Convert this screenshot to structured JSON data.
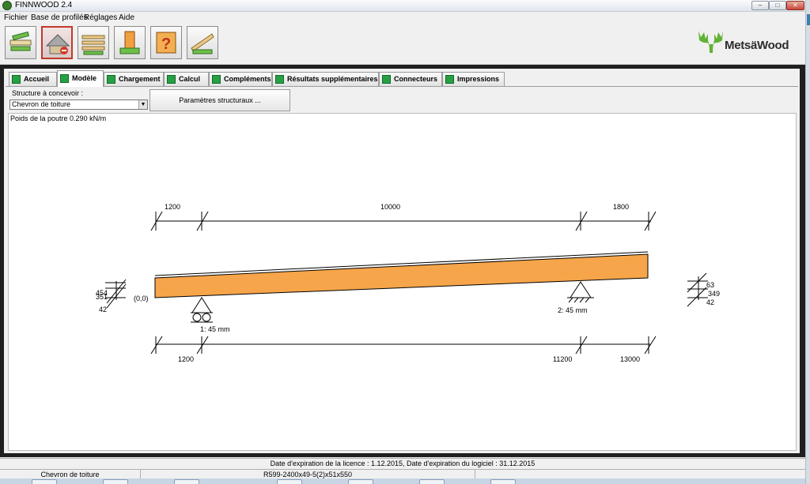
{
  "window": {
    "title": "FINNWOOD 2.4"
  },
  "menu": [
    {
      "label": "Fichier"
    },
    {
      "label": "Base de profilés"
    },
    {
      "label": "Réglages"
    },
    {
      "label": "Aide"
    }
  ],
  "toolbar": {
    "buttons": [
      {
        "icon": "beam-icon"
      },
      {
        "icon": "roof-model-icon"
      },
      {
        "icon": "floor-joists-icon"
      },
      {
        "icon": "column-icon"
      },
      {
        "icon": "help-icon"
      },
      {
        "icon": "truss-icon"
      }
    ],
    "logo_text": "MetsäWood"
  },
  "tabs": [
    {
      "label": "Accueil"
    },
    {
      "label": "Modèle"
    },
    {
      "label": "Chargement"
    },
    {
      "label": "Calcul"
    },
    {
      "label": "Compléments"
    },
    {
      "label": "Résultats supplémentaires"
    },
    {
      "label": "Connecteurs"
    },
    {
      "label": "Impressions"
    }
  ],
  "model": {
    "structure_label": "Structure à concevoir :",
    "structure_value": "Chevron de toiture",
    "param_button": "Paramètres structuraux ...",
    "weight_text": "Poids de la poutre 0.290 kN/m"
  },
  "drawing": {
    "top_dims": [
      "1200",
      "10000",
      "1800"
    ],
    "bottom_dims": [
      "1200",
      "11200",
      "13000"
    ],
    "origin_label": "(0,0)",
    "left_heights": [
      "454",
      "351",
      "42"
    ],
    "right_heights": [
      "63",
      "349",
      "42"
    ],
    "support_1": "1: 45 mm",
    "support_2": "2: 45 mm",
    "beam_color": "#f7a54a"
  },
  "status": {
    "license": "Date d'expiration de la licence : 1.12.2015, Date d'expiration du logiciel : 31.12.2015",
    "structure": "Chevron de toiture",
    "profile": "R599-2400x49-5(2)x51x550"
  }
}
